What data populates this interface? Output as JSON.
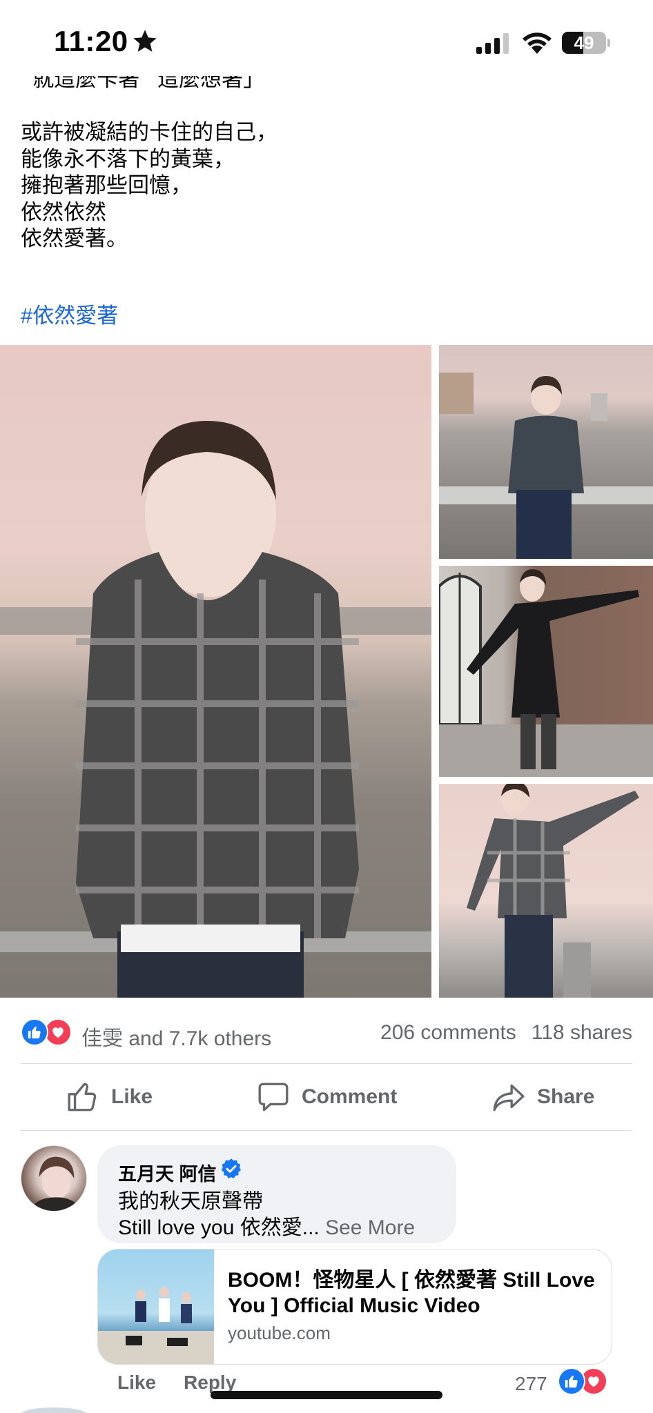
{
  "status_bar": {
    "time": "11:20",
    "battery": "49",
    "battery_level": 0.49
  },
  "post": {
    "lines": [
      "  就這麼卡著   這麼想著」",
      "",
      "或許被凝結的卡住的自己，",
      "能像永不落下的黃葉，",
      "擁抱著那些回憶，",
      "依然依然",
      "依然愛著。"
    ],
    "hashtag": "#依然愛著"
  },
  "reactions": {
    "names": "佳雯 and 7.7k others",
    "comments": "206 comments",
    "shares": "118 shares"
  },
  "actions": {
    "like": "Like",
    "comment": "Comment",
    "share": "Share"
  },
  "comment": {
    "author": "五月天 阿信",
    "line1": "我的秋天原聲帶",
    "line2": "Still love you 依然愛... ",
    "see_more": "See More",
    "link": {
      "title": "BOOM！怪物星人 [ 依然愛著 Still Love You ] Official Music Video",
      "domain": "youtube.com"
    },
    "like": "Like",
    "reply": "Reply",
    "reaction_count": "277"
  },
  "colors": {
    "facebook_blue": "#1877f2",
    "love_red": "#f33e58",
    "hashtag_blue": "#1a66d6",
    "muted_text": "#65676b",
    "bubble_bg": "#f0f2f5"
  }
}
